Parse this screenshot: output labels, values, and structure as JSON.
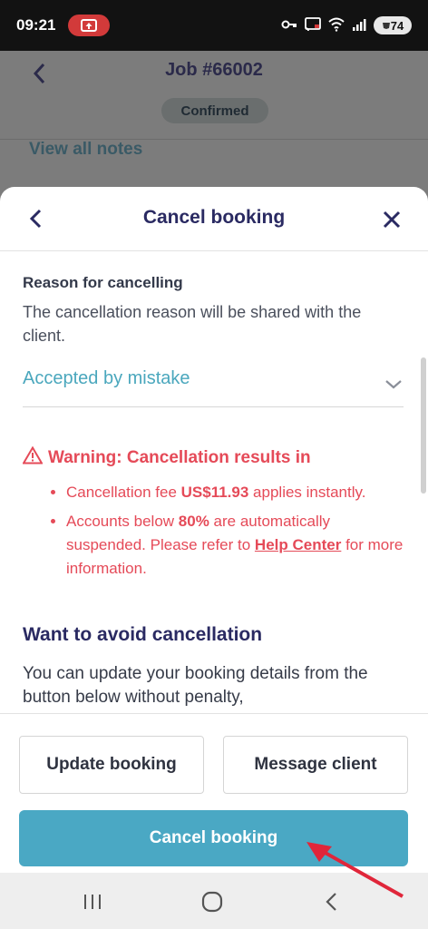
{
  "status_bar": {
    "time": "09:21",
    "battery": "74"
  },
  "background_page": {
    "title": "Job #66002",
    "status_badge": "Confirmed",
    "notes_link": "View all notes"
  },
  "sheet": {
    "title": "Cancel booking",
    "reason": {
      "label": "Reason for cancelling",
      "description": "The cancellation reason will be shared with the client.",
      "selected": "Accepted by mistake"
    },
    "warning": {
      "title": "Warning: Cancellation results in",
      "item1_pre": "Cancellation fee ",
      "item1_amount": "US$11.93",
      "item1_post": " applies instantly.",
      "item2_pre": "Accounts below ",
      "item2_pct": "80%",
      "item2_mid": " are automatically suspended. Please refer to ",
      "item2_link": "Help Center",
      "item2_post": " for more information."
    },
    "avoid": {
      "title": "Want to avoid cancellation",
      "text": "You can update your booking details from the button below without penalty,"
    },
    "buttons": {
      "update": "Update booking",
      "message": "Message client",
      "cancel": "Cancel booking"
    }
  },
  "colors": {
    "accent": "#4aa8c4",
    "warning": "#e54a58",
    "title": "#2a2a62",
    "annotation_arrow": "#e0263a"
  }
}
